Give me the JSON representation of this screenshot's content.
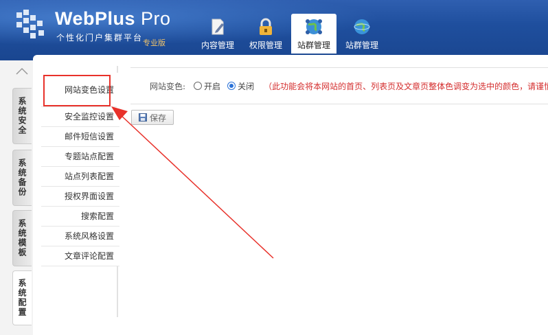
{
  "header": {
    "title_main": "WebPlus",
    "title_pro": " Pro",
    "subtitle": "个性化门户集群平台",
    "edition": "专业版",
    "nav": [
      {
        "label": "内容管理",
        "icon": "document-edit-icon",
        "active": false
      },
      {
        "label": "权限管理",
        "icon": "lock-icon",
        "active": false
      },
      {
        "label": "站群管理",
        "icon": "globe-network-icon",
        "active": true
      },
      {
        "label": "站群管理",
        "icon": "globe-icon",
        "active": false
      }
    ]
  },
  "side_tabs": [
    {
      "label": "系统安全",
      "active": false
    },
    {
      "label": "系统备份",
      "active": false
    },
    {
      "label": "系统模板",
      "active": false
    },
    {
      "label": "系统配置",
      "active": true
    }
  ],
  "submenu": [
    {
      "label": "网站变色设置",
      "active": true
    },
    {
      "label": "安全监控设置",
      "active": false
    },
    {
      "label": "邮件短信设置",
      "active": false
    },
    {
      "label": "专题站点配置",
      "active": false
    },
    {
      "label": "站点列表配置",
      "active": false
    },
    {
      "label": "授权界面设置",
      "active": false
    },
    {
      "label": "搜索配置",
      "active": false
    },
    {
      "label": "系统风格设置",
      "active": false
    },
    {
      "label": "文章评论配置",
      "active": false
    }
  ],
  "setting": {
    "label": "网站变色:",
    "options": [
      {
        "label": "开启",
        "checked": false
      },
      {
        "label": "关闭",
        "checked": true
      }
    ],
    "note": "（此功能会将本网站的首页、列表页及文章页整体色调变为选中的颜色，请谨慎操作！"
  },
  "save_label": "保存",
  "colors": {
    "header_blue": "#1f4f9e",
    "highlight_red": "#e8312a",
    "note_red": "#d42d2d",
    "radio_blue": "#2a72d8"
  }
}
